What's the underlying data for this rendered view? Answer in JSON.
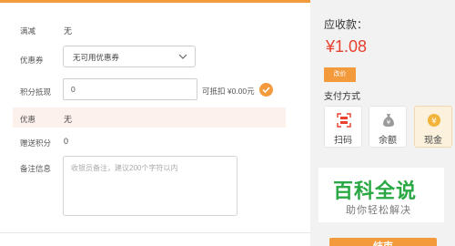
{
  "form": {
    "full_reduction": {
      "label": "满减",
      "value": "无"
    },
    "coupon": {
      "label": "优惠券",
      "selected": "无可用优惠券"
    },
    "points_redeem": {
      "label": "积分抵现",
      "value": "0",
      "deduct_text": "可抵扣 ¥0.00元"
    },
    "discount": {
      "label": "优惠",
      "value": "无"
    },
    "gift_points": {
      "label": "赠送积分",
      "value": "0"
    },
    "remark": {
      "label": "备注信息",
      "placeholder": "收银员备注，建议200个字符以内"
    }
  },
  "summary": {
    "amount_due_label": "应收款：",
    "amount_due": "¥1.08",
    "change_price_label": "改价",
    "payment_method_label": "支付方式",
    "payment_methods": [
      {
        "label": "扫码",
        "icon": "qr-scan-icon"
      },
      {
        "label": "余额",
        "icon": "money-bag-icon"
      },
      {
        "label": "现金",
        "icon": "cash-coin-icon"
      }
    ],
    "settle_label": "结束"
  },
  "watermark": {
    "main": "百科全说",
    "sub": "助你轻松解决"
  },
  "colors": {
    "accent": "#f39a3d",
    "price": "#e8402f",
    "watermark": "#2aa844",
    "discount_bg": "#fdf1ec"
  }
}
